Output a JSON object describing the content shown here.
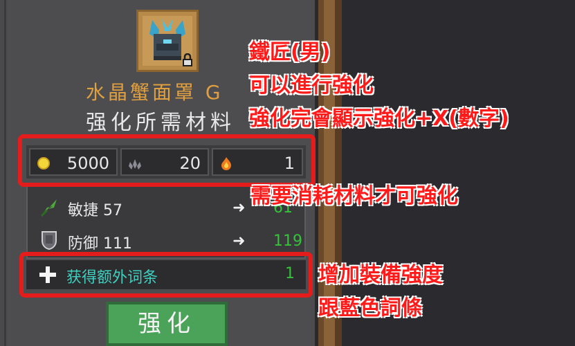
{
  "item": {
    "name": "水晶蟹面罩 G",
    "icon": "crystal-crab-mask-icon",
    "locked": true
  },
  "materials_title": "强化所需材料",
  "costs": {
    "gold": "5000",
    "crystal": "20",
    "flame": "1"
  },
  "stats": [
    {
      "icon": "agility-feather-icon",
      "label": "敏捷 57",
      "new_value": "61"
    },
    {
      "icon": "defense-shield-icon",
      "label": "防御 111",
      "new_value": "119"
    }
  ],
  "affix": {
    "label": "获得额外词条",
    "count": "1"
  },
  "enhance_button": "强化",
  "annotations": {
    "note1_line1": "鐵匠(男)",
    "note1_line2": "可以進行強化",
    "note1_line3": "強化完會顯示強化+X(數字)",
    "note2": "需要消耗材料才可強化",
    "note3_line1": "增加裝備強度",
    "note3_line2": "跟藍色詞條"
  },
  "colors": {
    "annotation_red": "#e51c1c",
    "item_name_gold": "#e0a040",
    "stat_green": "#36c23a",
    "affix_cyan": "#3fd0c0",
    "button_green": "#4ba35a"
  }
}
